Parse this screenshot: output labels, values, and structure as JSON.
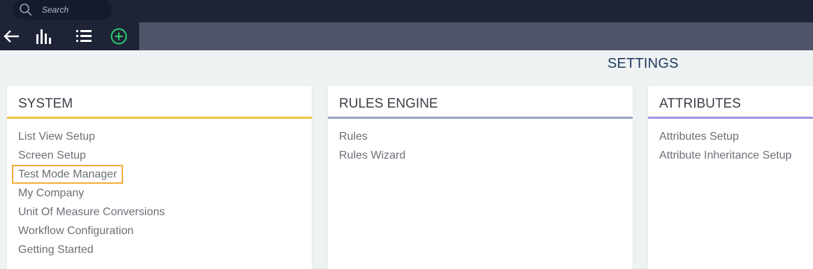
{
  "topbar": {
    "search_placeholder": "Search",
    "search_icon": "search-icon"
  },
  "toolbar": {
    "icons": [
      "back-arrow-icon",
      "bar-chart-icon",
      "list-icon",
      "add-circle-icon"
    ],
    "add_icon_color": "#2ecc71"
  },
  "page_title": "SETTINGS",
  "panels": [
    {
      "title": "SYSTEM",
      "accent": "#f5c342",
      "items": [
        "List View Setup",
        "Screen Setup",
        "Test Mode Manager",
        "My Company",
        "Unit Of Measure Conversions",
        "Workflow Configuration",
        "Getting Started"
      ],
      "highlighted_item": "Test Mode Manager",
      "highlight_color": "#f5ac38"
    },
    {
      "title": "RULES ENGINE",
      "accent": "#9aa3bd",
      "items": [
        "Rules",
        "Rules Wizard"
      ]
    },
    {
      "title": "ATTRIBUTES",
      "accent": "#9b96e6",
      "items": [
        "Attributes Setup",
        "Attribute Inheritance Setup"
      ]
    }
  ]
}
